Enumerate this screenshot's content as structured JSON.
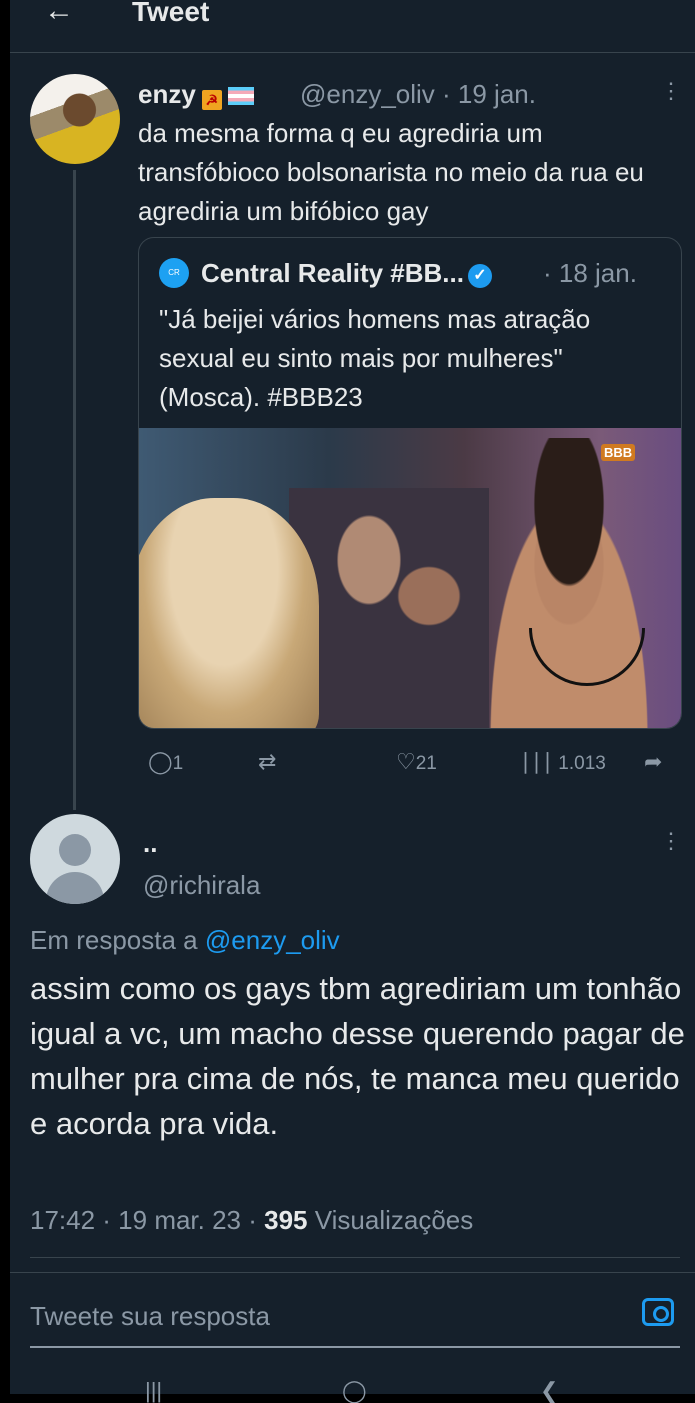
{
  "header": {
    "back_icon": "arrow-left-icon",
    "title": "Tweet"
  },
  "original_tweet": {
    "author_name": "enzy",
    "handle": "@enzy_oliv",
    "date": "· 19 jan.",
    "text": "da mesma forma q eu agrediria um transfóbioco bolsonarista no meio da rua eu agrediria um bifóbico gay",
    "quoted_tweet": {
      "author_name": "Central Reality #BB...",
      "date": "· 18 jan.",
      "text": "\"Já beijei vários homens mas atração sexual eu sinto mais por mulheres\" (Mosca). #BBB23",
      "image_logo": "BBB"
    },
    "actions": {
      "replies": "1",
      "likes": "21",
      "views": "1.013"
    }
  },
  "reply_tweet": {
    "author_name": "..",
    "handle": "@richirala",
    "reply_prefix": "Em resposta a",
    "reply_to": "@enzy_oliv",
    "text": "assim como os gays tbm agrediriam um tonhão igual a vc, um macho desse querendo pagar de mulher pra cima de nós, te manca meu querido e acorda pra vida.",
    "time": "17:42 · 19 mar. 23 ·",
    "views_count": "395",
    "views_label": "Visualizações"
  },
  "compose": {
    "placeholder": "Tweete sua resposta"
  },
  "colors": {
    "background": "#15202b",
    "accent": "#1d9bf0",
    "muted": "#8b98a5",
    "border": "#38444d"
  }
}
